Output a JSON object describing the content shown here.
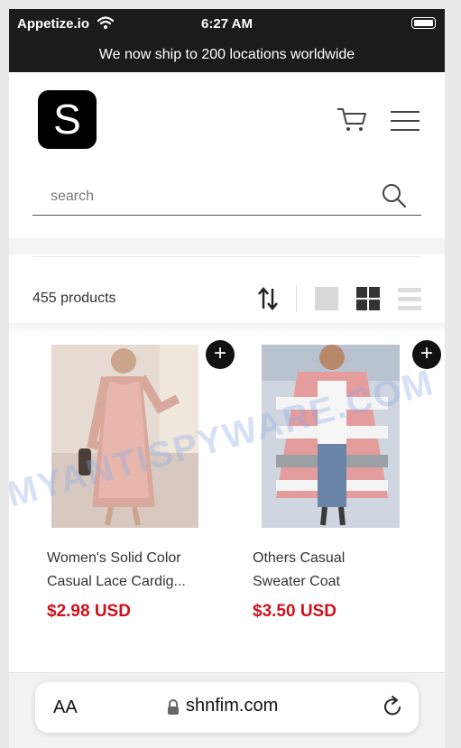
{
  "status_bar": {
    "carrier": "Appetize.io",
    "time": "6:27 AM"
  },
  "announcement": "We now ship to 200 locations worldwide",
  "header": {
    "logo_letter": "S"
  },
  "search": {
    "placeholder": "search"
  },
  "toolbar": {
    "product_count": "455 products"
  },
  "products": [
    {
      "title_line1": "Women's Solid Color",
      "title_line2": "Casual Lace Cardig...",
      "price": "$2.98 USD"
    },
    {
      "title_line1": "Others Casual",
      "title_line2": "Sweater Coat",
      "price": "$3.50 USD"
    }
  ],
  "browser": {
    "aa_label": "AA",
    "url": "shnfim.com"
  },
  "watermark": "MYANTISPYWARE.COM",
  "colors": {
    "price": "#d0101b",
    "bar": "#1b1b1b"
  }
}
